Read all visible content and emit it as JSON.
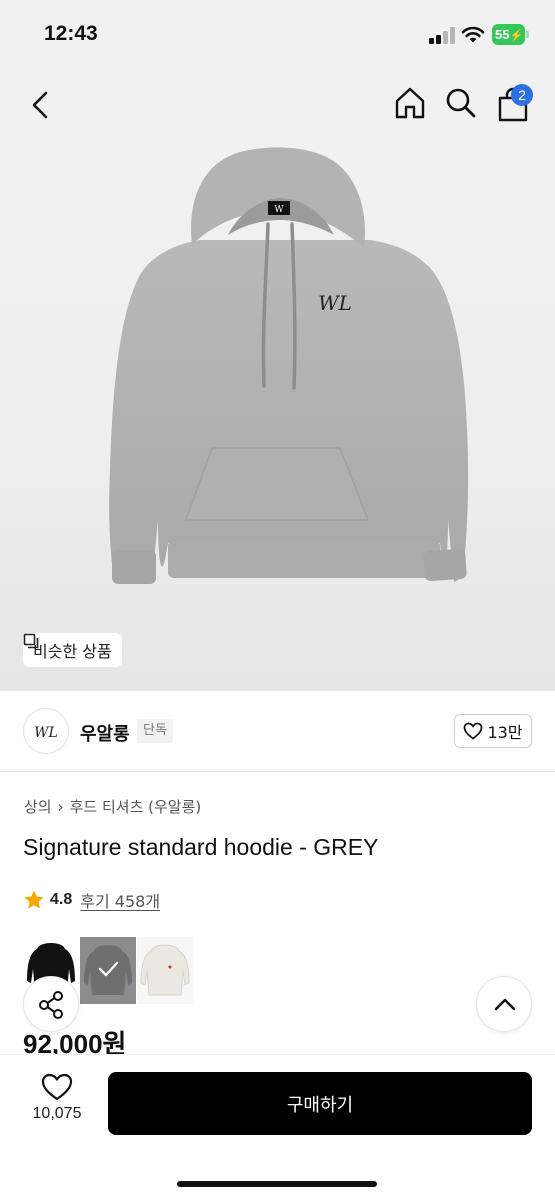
{
  "status_bar": {
    "time": "12:43",
    "battery": "55"
  },
  "nav": {
    "cart_count": "2"
  },
  "hero": {
    "similar_label": "비슷한 상품"
  },
  "brand": {
    "name": "우알롱",
    "tag": "단독",
    "likes": "13만"
  },
  "breadcrumb": {
    "category": "상의",
    "subcategory": "후드 티셔츠 (우알롱)"
  },
  "product": {
    "title": "Signature standard hoodie - GREY",
    "rating": "4.8",
    "reviews": "후기 458개",
    "price": "92,000원",
    "colors": [
      "black",
      "grey",
      "ivory"
    ],
    "selected_color": "grey"
  },
  "bottom": {
    "wish_count": "10,075",
    "buy_label": "구매하기"
  },
  "colors": {
    "brand_blue": "#2f6fe4",
    "star": "#f7a600",
    "battery": "#34c759"
  }
}
